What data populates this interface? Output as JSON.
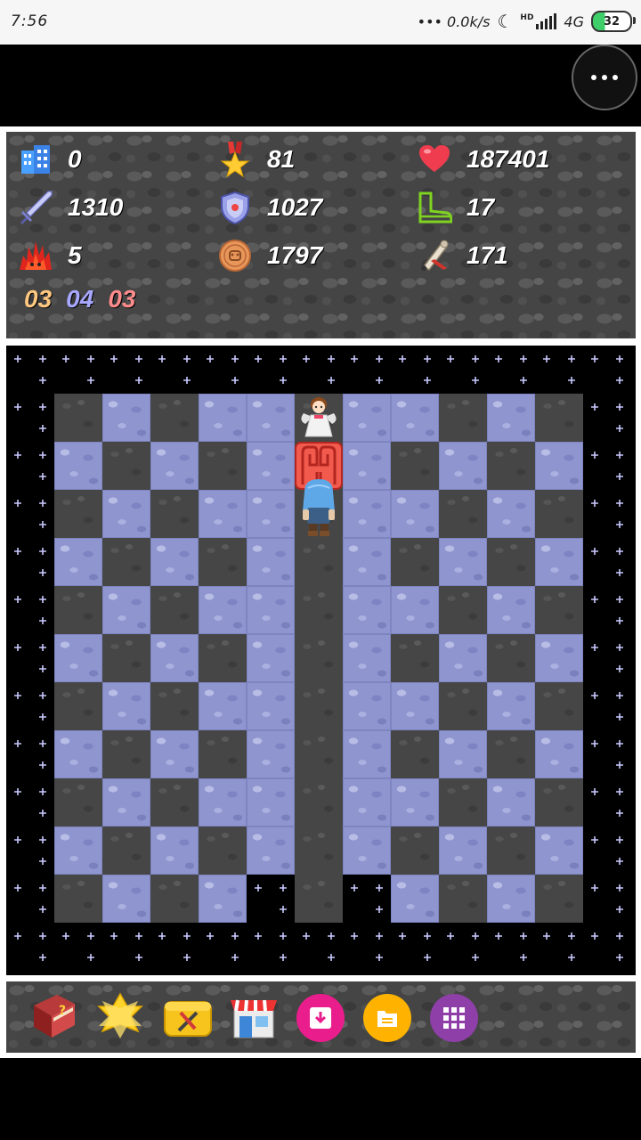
{
  "status_bar": {
    "time": "7:56",
    "network_speed": "••• 0.0k/s",
    "network_type": "4G",
    "hd_label": "HD",
    "battery": "32"
  },
  "stats": {
    "floor": "0",
    "level": "81",
    "hp": "187401",
    "attack": "1310",
    "defense": "1027",
    "agility": "17",
    "magic_defense": "5",
    "gold": "1797",
    "experience": "171"
  },
  "keys": {
    "yellow": "03",
    "blue": "04",
    "red": "03",
    "colors": {
      "yellow": "#ffc880",
      "blue": "#a8a8ff",
      "red": "#ff8c8c"
    }
  },
  "map": {
    "grid_size": 13,
    "legend": {
      "S": "starfield",
      "W": "blue-stone-wall",
      "F": "dark-floor"
    },
    "rows": [
      "SSSSSSSSSSSSS",
      "SFWFWWFWWFWFS",
      "SWFWFWFWFWFWS",
      "SFWFWWFWWFWFS",
      "SWFWFWFWFWFWS",
      "SFWFWWFWWFWFS",
      "SWFWFWFWFWFWS",
      "SFWFWWFWWFWFS",
      "SWFWFWFWFWFWS",
      "SFWFWWFWWFWFS",
      "SWFWFWFWFWFWS",
      "SFWFWSFSWFWFS",
      "SSSSSSSSSSSSS"
    ],
    "sprites": [
      {
        "type": "fairy-npc",
        "col": 6,
        "row": 1
      },
      {
        "type": "red-magic-door",
        "col": 6,
        "row": 2
      },
      {
        "type": "hero",
        "col": 6,
        "row": 3
      }
    ]
  },
  "toolbar": [
    {
      "name": "monster-manual-icon"
    },
    {
      "name": "fly-star-icon"
    },
    {
      "name": "toolbox-icon"
    },
    {
      "name": "shop-icon"
    },
    {
      "name": "save-icon"
    },
    {
      "name": "load-icon"
    },
    {
      "name": "menu-grid-icon"
    }
  ]
}
